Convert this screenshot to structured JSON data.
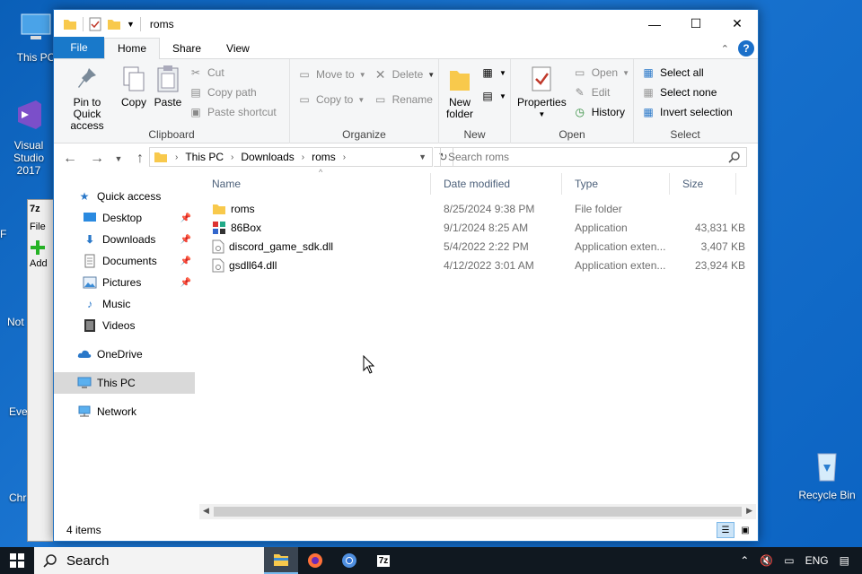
{
  "desktop": {
    "icons": [
      {
        "label": "This PC"
      },
      {
        "label": "Visual Studio 2017"
      },
      {
        "label": "Recycle Bin"
      }
    ],
    "partial_labels": [
      "F",
      "Not",
      "Eve",
      "Chr"
    ]
  },
  "bg_window": {
    "title_glyph": "7z",
    "menu_file": "File",
    "add_label": "Add"
  },
  "window": {
    "title": "roms",
    "minimize": "—",
    "maximize": "☐",
    "close": "✕"
  },
  "ribbon_tabs": [
    "File",
    "Home",
    "Share",
    "View"
  ],
  "ribbon": {
    "clipboard": {
      "label": "Clipboard",
      "pin": "Pin to Quick access",
      "copy": "Copy",
      "paste": "Paste",
      "cut": "Cut",
      "copy_path": "Copy path",
      "paste_shortcut": "Paste shortcut"
    },
    "organize": {
      "label": "Organize",
      "move_to": "Move to",
      "copy_to": "Copy to",
      "delete": "Delete",
      "rename": "Rename"
    },
    "new": {
      "label": "New",
      "new_folder": "New folder"
    },
    "open": {
      "label": "Open",
      "properties": "Properties",
      "open": "Open",
      "edit": "Edit",
      "history": "History"
    },
    "select": {
      "label": "Select",
      "select_all": "Select all",
      "select_none": "Select none",
      "invert": "Invert selection"
    }
  },
  "address": {
    "crumbs": [
      "This PC",
      "Downloads",
      "roms"
    ],
    "search_placeholder": "Search roms"
  },
  "nav": {
    "quick_access": "Quick access",
    "items": [
      {
        "label": "Desktop",
        "icon": "desktop-icon"
      },
      {
        "label": "Downloads",
        "icon": "downloads-icon"
      },
      {
        "label": "Documents",
        "icon": "documents-icon"
      },
      {
        "label": "Pictures",
        "icon": "pictures-icon"
      },
      {
        "label": "Music",
        "icon": "music-icon"
      },
      {
        "label": "Videos",
        "icon": "videos-icon"
      }
    ],
    "onedrive": "OneDrive",
    "this_pc": "This PC",
    "network": "Network"
  },
  "columns": {
    "name": "Name",
    "date": "Date modified",
    "type": "Type",
    "size": "Size"
  },
  "files": [
    {
      "name": "roms",
      "date": "8/25/2024 9:38 PM",
      "type": "File folder",
      "size": "",
      "icon": "folder-icon"
    },
    {
      "name": "86Box",
      "date": "9/1/2024 8:25 AM",
      "type": "Application",
      "size": "43,831 KB",
      "icon": "app-86box-icon"
    },
    {
      "name": "discord_game_sdk.dll",
      "date": "5/4/2022 2:22 PM",
      "type": "Application exten...",
      "size": "3,407 KB",
      "icon": "dll-icon"
    },
    {
      "name": "gsdll64.dll",
      "date": "4/12/2022 3:01 AM",
      "type": "Application exten...",
      "size": "23,924 KB",
      "icon": "dll-icon"
    }
  ],
  "status": {
    "count": "4 items"
  },
  "taskbar": {
    "search": "Search",
    "lang": "ENG"
  },
  "colors": {
    "accent": "#1979ca",
    "folder": "#f8c94c",
    "desktop": "#0b63c2"
  }
}
